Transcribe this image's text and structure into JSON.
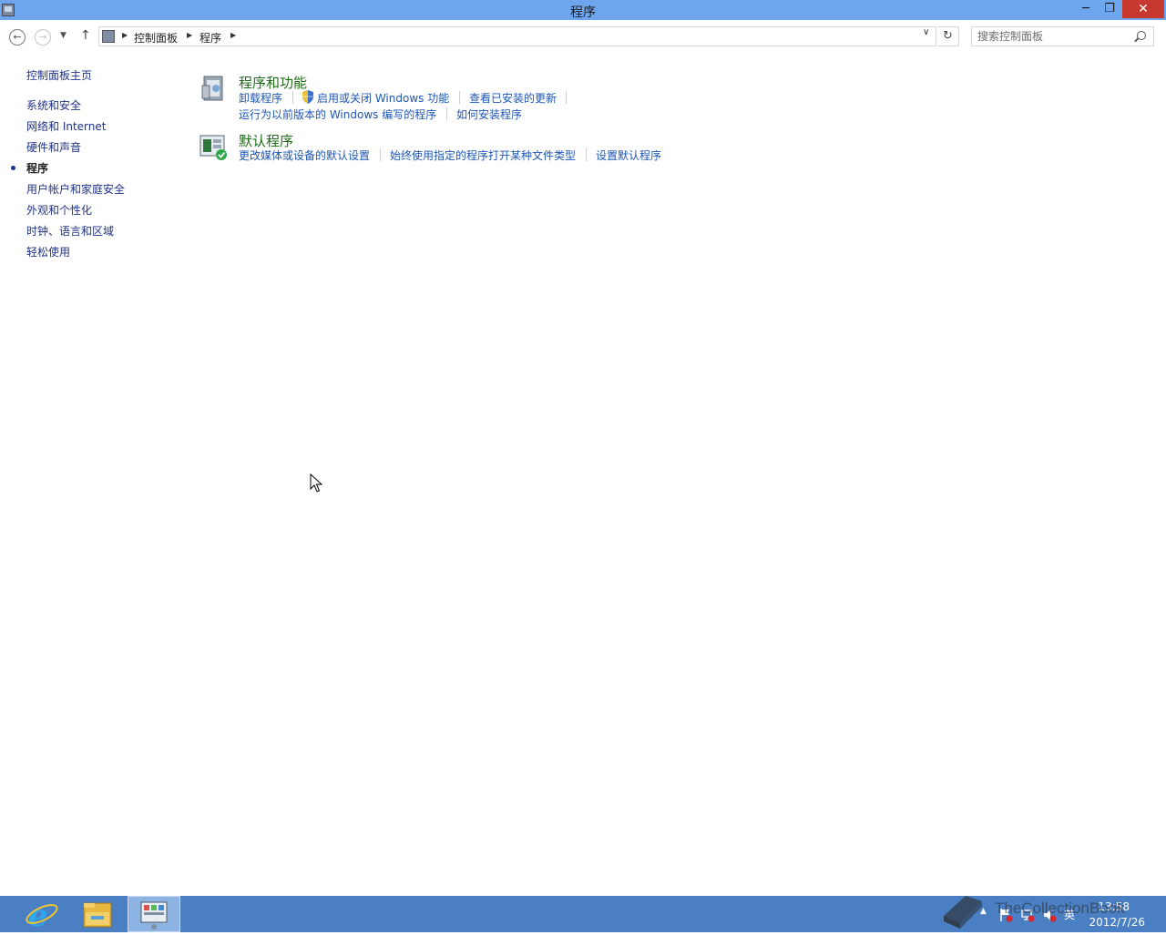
{
  "window": {
    "title": "程序",
    "minimize_label": "─",
    "maximize_label": "❐",
    "close_label": "✕"
  },
  "nav": {
    "back_label": "←",
    "forward_label": "→",
    "recent_label": "▼",
    "up_label": "↑",
    "breadcrumbs": [
      "控制面板",
      "程序"
    ],
    "address_dropdown_label": "∨",
    "refresh_label": "↻",
    "search_placeholder": "搜索控制面板"
  },
  "sidebar": {
    "home": "控制面板主页",
    "items": [
      {
        "label": "系统和安全",
        "current": false
      },
      {
        "label": "网络和 Internet",
        "current": false
      },
      {
        "label": "硬件和声音",
        "current": false
      },
      {
        "label": "程序",
        "current": true
      },
      {
        "label": "用户帐户和家庭安全",
        "current": false
      },
      {
        "label": "外观和个性化",
        "current": false
      },
      {
        "label": "时钟、语言和区域",
        "current": false
      },
      {
        "label": "轻松使用",
        "current": false
      }
    ]
  },
  "categories": [
    {
      "title": "程序和功能",
      "icon": "programs-features-icon",
      "links_row1": [
        "卸载程序",
        "启用或关闭 Windows 功能",
        "查看已安装的更新"
      ],
      "links_row2": [
        "运行为以前版本的 Windows 编写的程序",
        "如何安装程序"
      ]
    },
    {
      "title": "默认程序",
      "icon": "default-programs-icon",
      "links_row1": [
        "更改媒体或设备的默认设置",
        "始终使用指定的程序打开某种文件类型",
        "设置默认程序"
      ]
    }
  ],
  "taskbar": {
    "apps": [
      "internet-explorer-icon",
      "file-explorer-icon",
      "control-panel-icon"
    ],
    "tray_language": "英",
    "time": "13:58",
    "date": "2012/7/26"
  },
  "watermark": {
    "text": "TheCollectionBook"
  },
  "colors": {
    "titlebar": "#6ea6ee",
    "taskbar": "#4a7fc4",
    "link": "#1e56b4",
    "category_title": "#1e6b18",
    "close_button": "#c7392f"
  }
}
